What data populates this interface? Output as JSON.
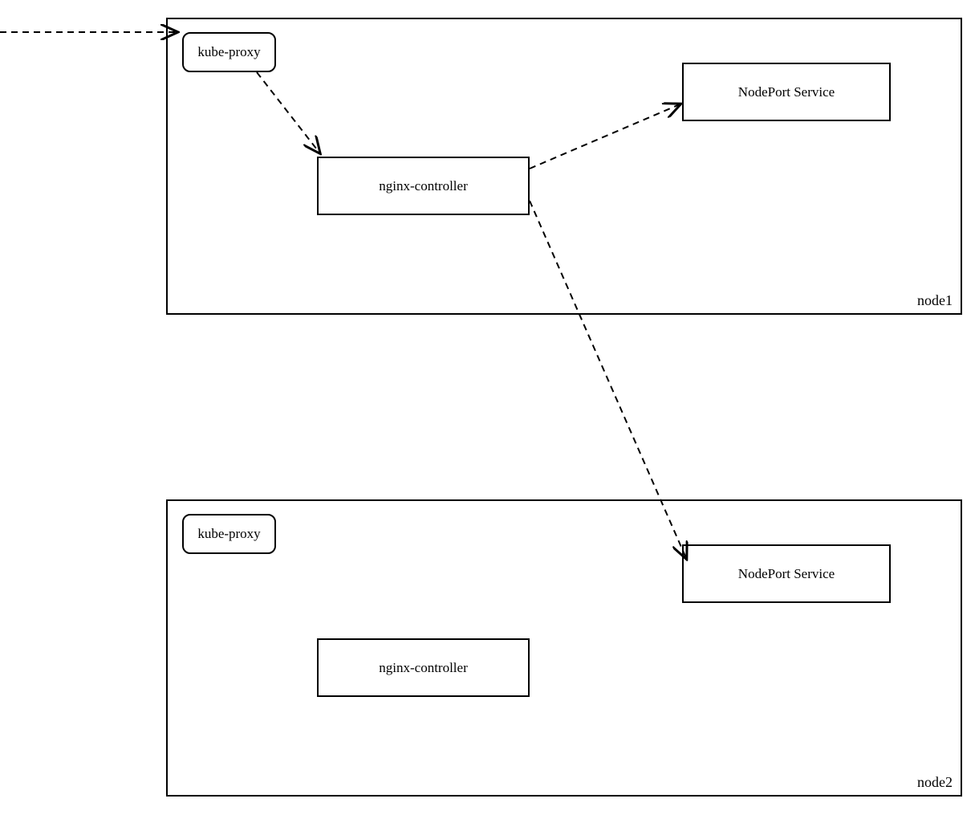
{
  "nodes": {
    "node1": {
      "label": "node1",
      "kube_proxy": "kube-proxy",
      "nginx_controller": "nginx-controller",
      "nodeport_service": "NodePort Service"
    },
    "node2": {
      "label": "node2",
      "kube_proxy": "kube-proxy",
      "nginx_controller": "nginx-controller",
      "nodeport_service": "NodePort Service"
    }
  },
  "arrows": [
    {
      "from": "external",
      "to": "node1.kube_proxy"
    },
    {
      "from": "node1.kube_proxy",
      "to": "node1.nginx_controller"
    },
    {
      "from": "node1.nginx_controller",
      "to": "node1.nodeport_service"
    },
    {
      "from": "node1.nginx_controller",
      "to": "node2.nodeport_service"
    }
  ]
}
